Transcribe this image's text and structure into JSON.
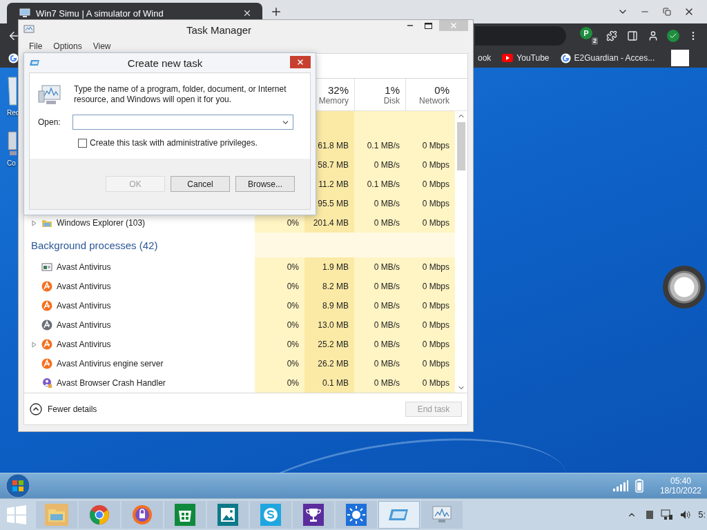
{
  "browser": {
    "tab": {
      "title": "Win7 Simu | A simulator of Wind"
    },
    "profile_badge": {
      "letter": "P",
      "count": "2"
    },
    "bookmarks": [
      {
        "label": "ook",
        "kind": "plain"
      },
      {
        "label": "YouTube",
        "kind": "youtube"
      },
      {
        "label": "E2Guardian - Acces...",
        "kind": "google"
      }
    ]
  },
  "desktop": {
    "icons": [
      {
        "label": "Rec",
        "kind": "bin"
      },
      {
        "label": "Co",
        "kind": "computer"
      }
    ]
  },
  "task_manager": {
    "title": "Task Manager",
    "menu": [
      "File",
      "Options",
      "View"
    ],
    "columns": [
      {
        "percent": "32%",
        "label": "Memory"
      },
      {
        "percent": "1%",
        "label": "Disk"
      },
      {
        "percent": "0%",
        "label": "Network"
      }
    ],
    "partly_hidden_rows": [
      {
        "memory": "61.8 MB",
        "disk": "0.1 MB/s",
        "network": "0 Mbps"
      },
      {
        "memory": "58.7 MB",
        "disk": "0 MB/s",
        "network": "0 Mbps"
      },
      {
        "memory": "11.2 MB",
        "disk": "0.1 MB/s",
        "network": "0 Mbps"
      },
      {
        "memory": "95.5 MB",
        "disk": "0 MB/s",
        "network": "0 Mbps"
      }
    ],
    "app_rows": [
      {
        "name": "Windows Explorer (103)",
        "kind": "explorer",
        "expandable": true,
        "cpu": "0%",
        "memory": "201.4 MB",
        "disk": "0 MB/s",
        "network": "0 Mbps"
      }
    ],
    "group": "Background processes (42)",
    "background_rows": [
      {
        "name": "Avast Antivirus",
        "kind": "window",
        "expandable": false,
        "cpu": "0%",
        "memory": "1.9 MB",
        "disk": "0 MB/s",
        "network": "0 Mbps"
      },
      {
        "name": "Avast Antivirus",
        "kind": "avast",
        "expandable": false,
        "cpu": "0%",
        "memory": "8.2 MB",
        "disk": "0 MB/s",
        "network": "0 Mbps"
      },
      {
        "name": "Avast Antivirus",
        "kind": "avast",
        "expandable": false,
        "cpu": "0%",
        "memory": "8.9 MB",
        "disk": "0 MB/s",
        "network": "0 Mbps"
      },
      {
        "name": "Avast Antivirus",
        "kind": "avast-grey",
        "expandable": false,
        "cpu": "0%",
        "memory": "13.0 MB",
        "disk": "0 MB/s",
        "network": "0 Mbps"
      },
      {
        "name": "Avast Antivirus",
        "kind": "avast",
        "expandable": true,
        "cpu": "0%",
        "memory": "25.2 MB",
        "disk": "0 MB/s",
        "network": "0 Mbps"
      },
      {
        "name": "Avast Antivirus engine server",
        "kind": "avast",
        "expandable": false,
        "cpu": "0%",
        "memory": "26.2 MB",
        "disk": "0 MB/s",
        "network": "0 Mbps"
      },
      {
        "name": "Avast Browser Crash Handler",
        "kind": "crash",
        "expandable": false,
        "cpu": "0%",
        "memory": "0.1 MB",
        "disk": "0 MB/s",
        "network": "0 Mbps"
      }
    ],
    "footer": {
      "toggle": "Fewer details",
      "end_task": {
        "label": "End task",
        "disabled": true
      }
    }
  },
  "dialog": {
    "title": "Create new task",
    "message": "Type the name of a program, folder, document, or Internet resource, and Windows will open it for you.",
    "open_label": "Open:",
    "admin_checkbox": {
      "label": "Create this task with administrative privileges.",
      "checked": false
    },
    "buttons": [
      {
        "label": "OK",
        "disabled": true
      },
      {
        "label": "Cancel",
        "disabled": false
      },
      {
        "label": "Browse...",
        "disabled": false
      }
    ]
  },
  "win7_taskbar": {
    "time": "05:40",
    "date": "18/10/2022"
  },
  "taskbar": {
    "apps": [
      {
        "kind": "explorer",
        "selected": false
      },
      {
        "kind": "chrome",
        "selected": false
      },
      {
        "kind": "secure-browser",
        "selected": false
      },
      {
        "kind": "store",
        "selected": false
      },
      {
        "kind": "photos",
        "selected": false
      },
      {
        "kind": "skype",
        "selected": false
      },
      {
        "kind": "trophy",
        "selected": false
      },
      {
        "kind": "sun",
        "selected": false
      },
      {
        "kind": "tablet",
        "selected": true
      },
      {
        "kind": "monitor",
        "selected": false
      }
    ],
    "clock": "5:"
  }
}
